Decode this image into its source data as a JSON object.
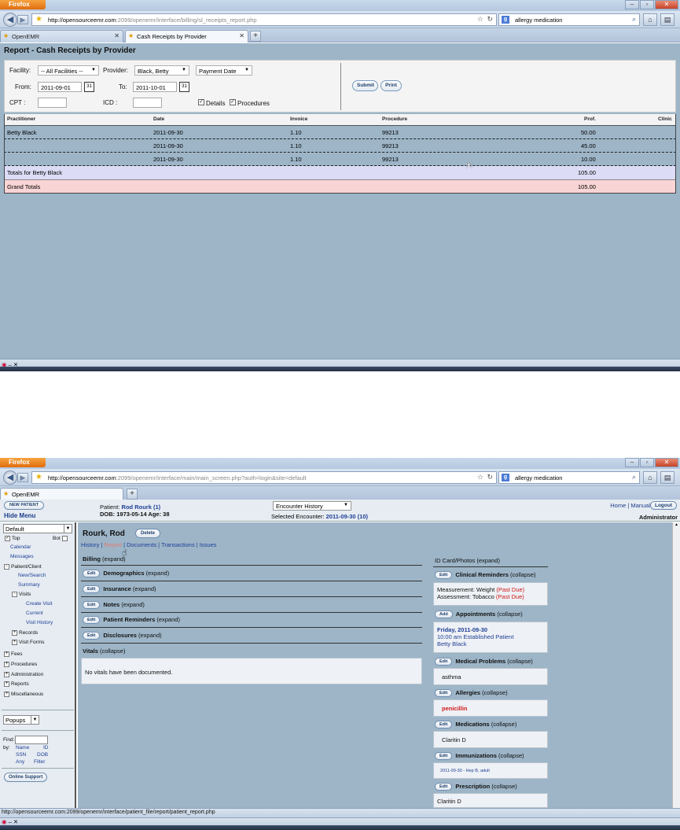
{
  "browser": {
    "menu_label": "Firefox",
    "search_query": "allergy medication"
  },
  "shot1": {
    "url_host": "http://opensourceemr.com",
    "url_rest": ":2099/openemr/interface/billing/sl_receipts_report.php",
    "tabs": [
      {
        "label": "OpenEMR"
      },
      {
        "label": "Cash Receipts by Provider"
      }
    ],
    "report": {
      "title": "Report - Cash Receipts by Provider",
      "facility_label": "Facility:",
      "facility_value": "-- All Facilities --",
      "provider_label": "Provider:",
      "provider_value": "Black, Betty",
      "date_type_value": "Payment Date",
      "from_label": "From:",
      "from_value": "2011-09-01",
      "to_label": "To:",
      "to_value": "2011-10-01",
      "cpt_label": "CPT :",
      "icd_label": "ICD :",
      "details_label": "Details",
      "procedures_label": "Procedures",
      "submit_label": "Submit",
      "print_label": "Print"
    },
    "table": {
      "headers": [
        "Practitioner",
        "Date",
        "Invoice",
        "Procedure",
        "Prof.",
        "Clinic"
      ],
      "rows": [
        {
          "practitioner": "Betty Black",
          "date": "2011-09-30",
          "invoice": "1.10",
          "procedure": "99213",
          "prof": "50.00"
        },
        {
          "practitioner": "",
          "date": "2011-09-30",
          "invoice": "1.10",
          "procedure": "99213",
          "prof": "45.00"
        },
        {
          "practitioner": "",
          "date": "2011-09-30",
          "invoice": "1.10",
          "procedure": "99213",
          "prof": "10.00"
        }
      ],
      "totals_label": "Totals for Betty Black",
      "totals_value": "105.00",
      "grand_label": "Grand Totals",
      "grand_value": "105.00"
    }
  },
  "shot2": {
    "url_host": "http://opensourceemr.com",
    "url_rest": ":2099/openemr/interface/main/main_screen.php?auth=login&site=default",
    "tabs": [
      {
        "label": "OpenEMR"
      }
    ],
    "status_url": "http://opensourceemr.com:2099/openemr/interface/patient_file/report/patient_report.php",
    "header": {
      "new_patient": "NEW PATIENT",
      "hide_menu": "Hide Menu",
      "patient_label": "Patient:",
      "patient_name": "Rod Rourk (1)",
      "dob_line": "DOB: 1973-05-14 Age: 38",
      "encounter_select": "Encounter History",
      "selected_enc_label": "Selected Encounter:",
      "selected_enc_value": "2011-09-30 (10)",
      "home": "Home",
      "manual": "Manual",
      "logout": "Logout",
      "user": "Administrator"
    },
    "nav": {
      "layout_select": "Default",
      "top": "Top",
      "bot": "Bot",
      "calendar": "Calendar",
      "messages": "Messages",
      "patient_client": "Patient/Client",
      "new_search": "New/Search",
      "summary": "Summary",
      "visits": "Visits",
      "create_visit": "Create Visit",
      "current": "Current",
      "visit_history": "Visit History",
      "records": "Records",
      "visit_forms": "Visit Forms",
      "fees": "Fees",
      "procedures": "Procedures",
      "administration": "Administration",
      "reports": "Reports",
      "miscellaneous": "Miscellaneous",
      "popups": "Popups",
      "find": "Find:",
      "by": "by:",
      "name": "Name",
      "id": "ID",
      "ssn": "SSN",
      "dob": "DOB",
      "any": "Any",
      "filter": "Filter",
      "online_support": "Online Support"
    },
    "patient": {
      "name": "Rourk, Rod",
      "delete": "Delete",
      "links": {
        "history": "History",
        "report": "Report",
        "documents": "Documents",
        "transactions": "Transactions",
        "issues": "Issues"
      },
      "edit": "Edit",
      "add": "Add",
      "billing": "Billing",
      "demographics": "Demographics",
      "insurance": "Insurance",
      "notes": "Notes",
      "patient_reminders": "Patient Reminders",
      "disclosures": "Disclosures",
      "vitals": "Vitals",
      "expand": "(expand)",
      "collapse": "(collapse)",
      "vitals_text": "No vitals have been documented.",
      "id_card": "ID Card/Photos",
      "clinical_reminders": "Clinical Reminders",
      "reminder1": "Measurement: Weight",
      "reminder2": "Assessment: Tobacco",
      "past_due": "(Past Due)",
      "appointments": "Appointments",
      "appt_date": "Friday, 2011-09-30",
      "appt_line": "10:00 am Established Patient",
      "appt_provider": "Betty Black",
      "medical_problems": "Medical Problems",
      "problem1": "asthma",
      "allergies": "Allergies",
      "allergy1": "penicillin",
      "medications": "Medications",
      "med1": "Claritin D",
      "immunizations": "Immunizations",
      "imm1": "2011-09-30 - Hep B, adult",
      "prescription": "Prescription",
      "rx1": "Claritin D"
    }
  }
}
